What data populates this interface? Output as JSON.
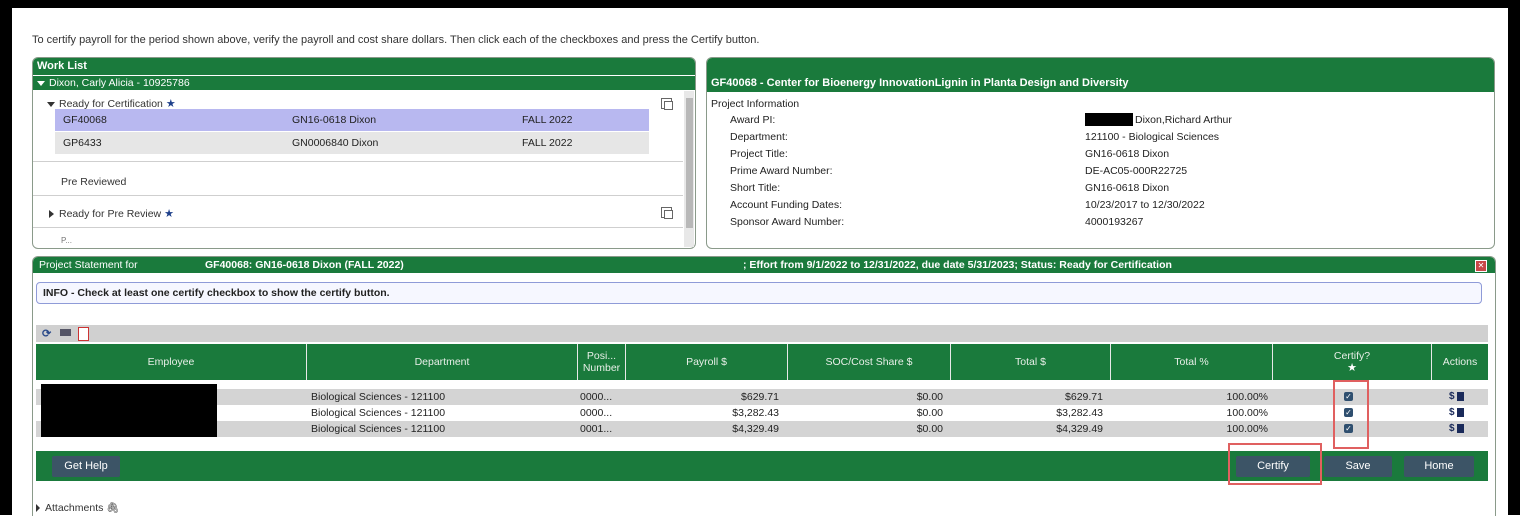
{
  "instruction": "To certify payroll for the period shown above, verify the payroll and cost share dollars. Then click each of the checkboxes and press the Certify button.",
  "worklist": {
    "title": "Work List",
    "person": "Dixon, Carly Alicia - 10925786",
    "sections": {
      "ready_cert": "Ready for Certification",
      "pre_reviewed": "Pre Reviewed",
      "ready_pre_review": "Ready for Pre Review",
      "partial": "P..."
    },
    "rows": [
      {
        "id": "GF40068",
        "project": "GN16-0618 Dixon",
        "term": "FALL 2022"
      },
      {
        "id": "GP6433",
        "project": "GN0006840 Dixon",
        "term": "FALL 2022"
      }
    ]
  },
  "project": {
    "title": "GF40068 - Center for Bioenergy InnovationLignin in Planta Design and Diversity",
    "section": "Project Information",
    "labels": {
      "award_pi": "Award PI:",
      "department": "Department:",
      "project_title": "Project Title:",
      "prime_award": "Prime Award Number:",
      "short_title": "Short Title:",
      "funding_dates": "Account Funding Dates:",
      "sponsor_award": "Sponsor Award Number:"
    },
    "values": {
      "award_pi": "Dixon,Richard Arthur",
      "department": "121100 - Biological Sciences",
      "project_title": "GN16-0618 Dixon",
      "prime_award": "DE-AC05-000R22725",
      "short_title": "GN16-0618 Dixon",
      "funding_dates": "10/23/2017 to 12/30/2022",
      "sponsor_award": "4000193267"
    }
  },
  "statement": {
    "label": "Project Statement for",
    "subject": "GF40068: GN16-0618 Dixon (FALL 2022)",
    "effort": "; Effort from 9/1/2022 to 12/31/2022, due date 5/31/2023; Status: Ready for Certification",
    "info": "INFO - Check at least one certify checkbox to show the certify button.",
    "columns": {
      "employee": "Employee",
      "department": "Department",
      "position": "Posi... Number",
      "payroll": "Payroll $",
      "soc": "SOC/Cost Share $",
      "total": "Total $",
      "total_pct": "Total %",
      "certify": "Certify?",
      "actions": "Actions"
    },
    "rows": [
      {
        "department": "Biological Sciences - 121100",
        "position": "0000...",
        "payroll": "$629.71",
        "soc": "$0.00",
        "total": "$629.71",
        "pct": "100.00%"
      },
      {
        "department": "Biological Sciences - 121100",
        "position": "0000...",
        "payroll": "$3,282.43",
        "soc": "$0.00",
        "total": "$3,282.43",
        "pct": "100.00%"
      },
      {
        "department": "Biological Sciences - 121100",
        "position": "0001...",
        "payroll": "$4,329.49",
        "soc": "$0.00",
        "total": "$4,329.49",
        "pct": "100.00%"
      }
    ],
    "action_symbol": "$",
    "buttons": {
      "help": "Get Help",
      "certify": "Certify",
      "save": "Save",
      "home": "Home"
    },
    "attachments": "Attachments"
  },
  "colors": {
    "header_green": "#1a7a3c",
    "button": "#3c5466",
    "highlight": "#e06060",
    "row_selected": "#b8b8f0"
  }
}
